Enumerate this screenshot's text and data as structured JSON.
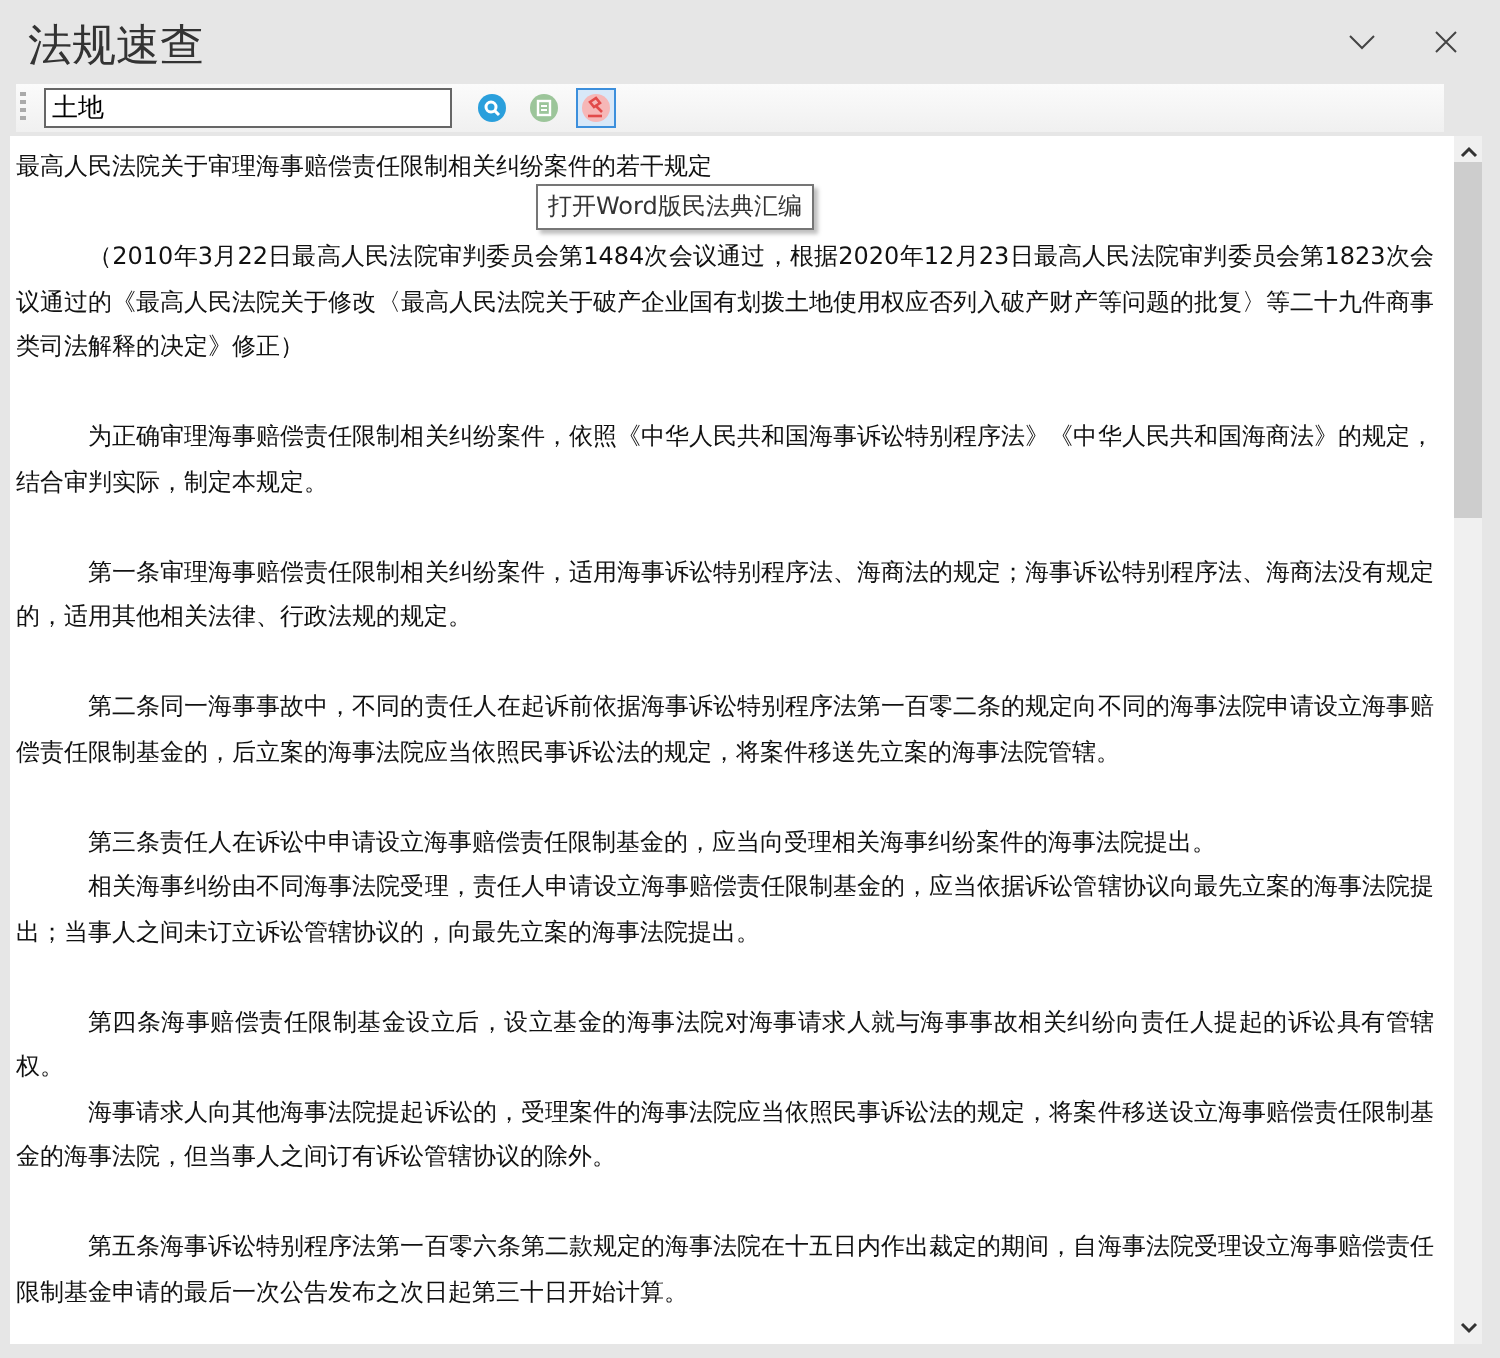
{
  "window": {
    "title": "法规速查"
  },
  "search": {
    "value": "土地"
  },
  "toolbar": [
    {
      "kind": "search",
      "selected": false
    },
    {
      "kind": "list",
      "selected": false
    },
    {
      "kind": "gavel",
      "selected": true
    }
  ],
  "tooltip": "打开Word版民法典汇编",
  "document": {
    "title": "最高人民法院关于审理海事赔偿责任限制相关纠纷案件的若干规定",
    "sections": [
      [
        "（2010年3月22日最高人民法院审判委员会第1484次会议通过，根据2020年12月23日最高人民法院审判委员会第1823次会议通过的《最高人民法院关于修改〈最高人民法院关于破产企业国有划拨土地使用权应否列入破产财产等问题的批复〉等二十九件商事类司法解释的决定》修正）"
      ],
      [
        "为正确审理海事赔偿责任限制相关纠纷案件，依照《中华人民共和国海事诉讼特别程序法》《中华人民共和国海商法》的规定，结合审判实际，制定本规定。"
      ],
      [
        "第一条审理海事赔偿责任限制相关纠纷案件，适用海事诉讼特别程序法、海商法的规定；海事诉讼特别程序法、海商法没有规定的，适用其他相关法律、行政法规的规定。"
      ],
      [
        "第二条同一海事事故中，不同的责任人在起诉前依据海事诉讼特别程序法第一百零二条的规定向不同的海事法院申请设立海事赔偿责任限制基金的，后立案的海事法院应当依照民事诉讼法的规定，将案件移送先立案的海事法院管辖。"
      ],
      [
        "第三条责任人在诉讼中申请设立海事赔偿责任限制基金的，应当向受理相关海事纠纷案件的海事法院提出。",
        "相关海事纠纷由不同海事法院受理，责任人申请设立海事赔偿责任限制基金的，应当依据诉讼管辖协议向最先立案的海事法院提出；当事人之间未订立诉讼管辖协议的，向最先立案的海事法院提出。"
      ],
      [
        "第四条海事赔偿责任限制基金设立后，设立基金的海事法院对海事请求人就与海事事故相关纠纷向责任人提起的诉讼具有管辖权。",
        "海事请求人向其他海事法院提起诉讼的，受理案件的海事法院应当依照民事诉讼法的规定，将案件移送设立海事赔偿责任限制基金的海事法院，但当事人之间订有诉讼管辖协议的除外。"
      ],
      [
        "第五条海事诉讼特别程序法第一百零六条第二款规定的海事法院在十五日内作出裁定的期间，自海事法院受理设立海事赔偿责任限制基金申请的最后一次公告发布之次日起第三十日开始计算。"
      ]
    ]
  }
}
